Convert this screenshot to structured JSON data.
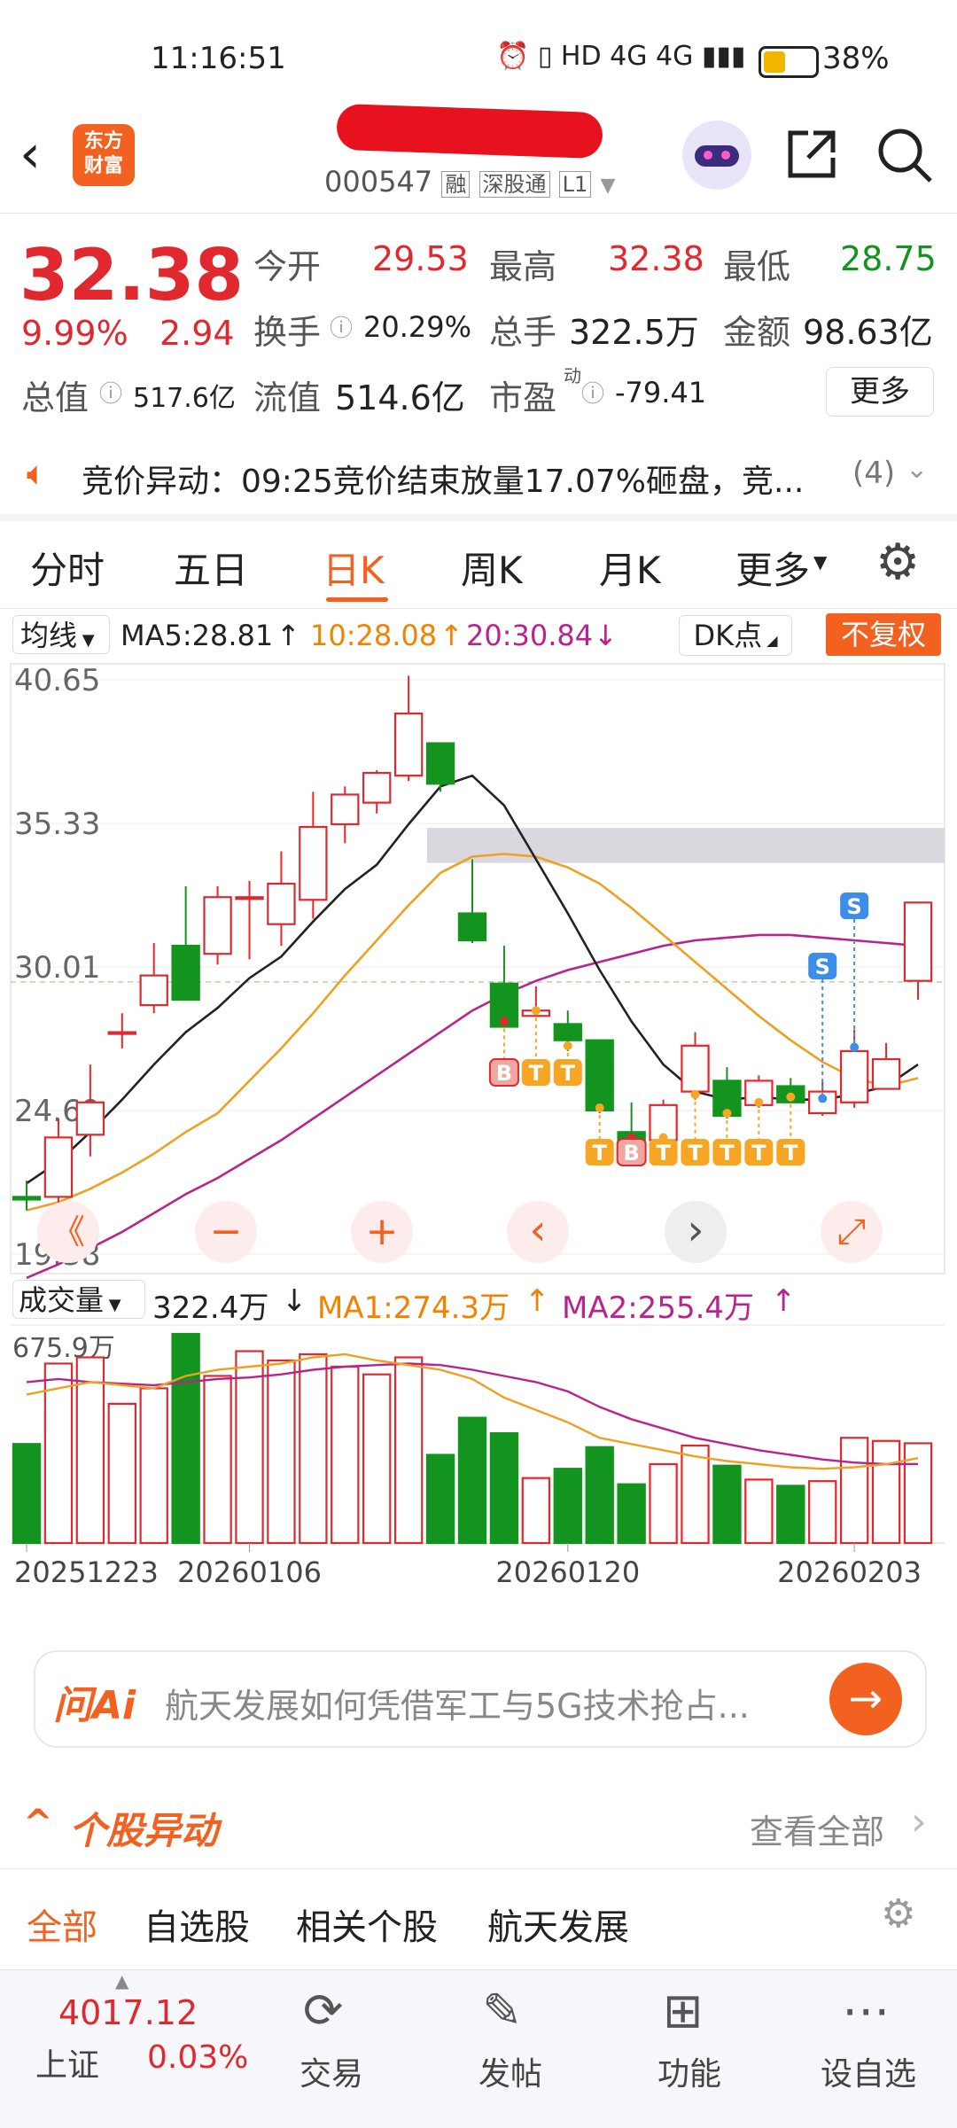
{
  "status": {
    "time": "11:16:51",
    "battery": "38%"
  },
  "header": {
    "logo_line1": "东方",
    "logo_line2": "财富",
    "code": "000547",
    "tag1": "融",
    "tag2": "深股通",
    "tag3": "L1"
  },
  "quote": {
    "price": "32.38",
    "change_pct": "9.99%",
    "change": "2.94",
    "open_label": "今开",
    "open": "29.53",
    "high_label": "最高",
    "high": "32.38",
    "low_label": "最低",
    "low": "28.75",
    "turnover_label": "换手",
    "turnover": "20.29%",
    "volume_label": "总手",
    "volume": "322.5万",
    "amount_label": "金额",
    "amount": "98.63亿",
    "mktcap_label": "总值",
    "mktcap": "517.6亿",
    "float_label": "流值",
    "float": "514.6亿",
    "pe_label": "市盈",
    "pe_sup": "动",
    "pe": "-79.41",
    "more": "更多"
  },
  "alert": {
    "text": "竞价异动：09:25竞价结束放量17.07%砸盘，竞...",
    "count": "(4)"
  },
  "tabs": [
    "分时",
    "五日",
    "日K",
    "周K",
    "月K",
    "更多"
  ],
  "indicator": {
    "ma_label": "均线",
    "ma5": "MA5:28.81",
    "ma10": "10:28.08",
    "ma20": "20:30.84",
    "dk": "DK点",
    "fq": "不复权"
  },
  "volume_bar": {
    "label": "成交量",
    "value": "322.4万",
    "ma1": "MA1:274.3万",
    "ma2": "MA2:255.4万",
    "max": "675.9万"
  },
  "colors": {
    "up": "#e0282e",
    "down": "#13941e",
    "accent": "#f2611f",
    "ma5": "#222222",
    "ma10": "#f0a020",
    "ma20": "#b8238c"
  },
  "chart_data": {
    "type": "candlestick",
    "y_ticks": [
      "40.65",
      "35.33",
      "30.01",
      "24.69",
      "19.38"
    ],
    "ylim": [
      19.38,
      40.65
    ],
    "x_labels": [
      "20251223",
      "20260106",
      "20260120",
      "20260203"
    ],
    "candles": [
      {
        "o": 21.5,
        "h": 22.1,
        "l": 21.0,
        "c": 21.4,
        "v": 320
      },
      {
        "o": 21.5,
        "h": 24.4,
        "l": 21.2,
        "c": 23.7,
        "v": 580
      },
      {
        "o": 23.8,
        "h": 26.4,
        "l": 23.0,
        "c": 25.0,
        "v": 600
      },
      {
        "o": 27.6,
        "h": 28.3,
        "l": 27.0,
        "c": 27.6,
        "v": 450
      },
      {
        "o": 28.6,
        "h": 30.9,
        "l": 28.3,
        "c": 29.7,
        "v": 500
      },
      {
        "o": 30.8,
        "h": 33.0,
        "l": 29.0,
        "c": 28.8,
        "v": 675.9
      },
      {
        "o": 30.5,
        "h": 33.0,
        "l": 30.1,
        "c": 32.6,
        "v": 540
      },
      {
        "o": 32.6,
        "h": 33.2,
        "l": 30.3,
        "c": 32.6,
        "v": 620
      },
      {
        "o": 31.6,
        "h": 34.3,
        "l": 30.8,
        "c": 33.1,
        "v": 590
      },
      {
        "o": 32.5,
        "h": 36.5,
        "l": 31.8,
        "c": 35.2,
        "v": 610
      },
      {
        "o": 35.3,
        "h": 36.7,
        "l": 34.6,
        "c": 36.4,
        "v": 570
      },
      {
        "o": 36.1,
        "h": 37.3,
        "l": 35.7,
        "c": 37.2,
        "v": 545
      },
      {
        "o": 37.1,
        "h": 40.8,
        "l": 36.9,
        "c": 39.4,
        "v": 600
      },
      {
        "o": 38.3,
        "h": 38.3,
        "l": 36.5,
        "c": 36.8,
        "v": 285
      },
      {
        "o": 32.0,
        "h": 34.0,
        "l": 30.9,
        "c": 31.0,
        "v": 405
      },
      {
        "o": 29.4,
        "h": 30.8,
        "l": 27.8,
        "c": 27.8,
        "v": 355
      },
      {
        "o": 28.2,
        "h": 29.3,
        "l": 28.2,
        "c": 28.4,
        "v": 210
      },
      {
        "o": 27.9,
        "h": 28.4,
        "l": 26.9,
        "c": 27.3,
        "v": 240
      },
      {
        "o": 27.3,
        "h": 27.3,
        "l": 24.6,
        "c": 24.7,
        "v": 310
      },
      {
        "o": 23.9,
        "h": 25.0,
        "l": 23.5,
        "c": 23.4,
        "v": 190
      },
      {
        "o": 23.6,
        "h": 25.1,
        "l": 23.5,
        "c": 24.9,
        "v": 255
      },
      {
        "o": 25.4,
        "h": 27.6,
        "l": 25.1,
        "c": 27.1,
        "v": 315
      },
      {
        "o": 25.8,
        "h": 26.3,
        "l": 24.4,
        "c": 24.5,
        "v": 250
      },
      {
        "o": 24.9,
        "h": 26.0,
        "l": 24.8,
        "c": 25.8,
        "v": 205
      },
      {
        "o": 25.6,
        "h": 25.9,
        "l": 25.0,
        "c": 25.0,
        "v": 185
      },
      {
        "o": 24.6,
        "h": 25.8,
        "l": 24.5,
        "c": 25.4,
        "v": 200
      },
      {
        "o": 25.0,
        "h": 27.7,
        "l": 24.8,
        "c": 26.9,
        "v": 340
      },
      {
        "o": 25.5,
        "h": 27.2,
        "l": 25.5,
        "c": 26.6,
        "v": 330
      },
      {
        "o": 29.5,
        "h": 32.4,
        "l": 28.8,
        "c": 32.4,
        "v": 322.4
      }
    ],
    "ma5": [
      22.0,
      22.8,
      23.9,
      25.1,
      26.4,
      27.6,
      28.5,
      29.6,
      30.4,
      31.7,
      32.9,
      33.8,
      35.3,
      36.7,
      37.1,
      36.0,
      34.0,
      32.0,
      29.9,
      28.0,
      26.4,
      25.4,
      25.1,
      25.2,
      25.1,
      25.1,
      25.3,
      25.6,
      26.4
    ],
    "ma10": [
      21.0,
      21.3,
      21.8,
      22.4,
      23.1,
      23.9,
      24.6,
      25.8,
      27.0,
      28.3,
      29.7,
      31.0,
      32.3,
      33.5,
      34.1,
      34.2,
      34.1,
      33.7,
      33.1,
      32.2,
      31.2,
      30.2,
      29.2,
      28.2,
      27.3,
      26.5,
      25.9,
      25.6,
      25.9
    ],
    "ma20": [
      18.5,
      19.0,
      19.6,
      20.2,
      20.9,
      21.6,
      22.2,
      22.9,
      23.6,
      24.4,
      25.2,
      26.0,
      26.8,
      27.6,
      28.4,
      29.0,
      29.5,
      29.9,
      30.2,
      30.5,
      30.8,
      31.0,
      31.1,
      31.2,
      31.2,
      31.1,
      31.0,
      30.9,
      30.8
    ],
    "vol_ma1": [
      480,
      500,
      520,
      510,
      500,
      540,
      560,
      570,
      580,
      600,
      610,
      590,
      575,
      560,
      530,
      470,
      430,
      390,
      340,
      320,
      300,
      280,
      265,
      255,
      245,
      240,
      245,
      255,
      274.3
    ],
    "vol_ma2": [
      520,
      530,
      520,
      515,
      510,
      520,
      530,
      535,
      545,
      560,
      570,
      575,
      580,
      575,
      560,
      540,
      520,
      490,
      440,
      400,
      370,
      340,
      320,
      300,
      285,
      270,
      260,
      255,
      255.4
    ],
    "signals": [
      {
        "i": 15,
        "t": "B"
      },
      {
        "i": 16,
        "t": "T"
      },
      {
        "i": 17,
        "t": "T"
      },
      {
        "i": 18,
        "t": "T"
      },
      {
        "i": 19,
        "t": "B"
      },
      {
        "i": 20,
        "t": "T"
      },
      {
        "i": 21,
        "t": "T"
      },
      {
        "i": 22,
        "t": "T"
      },
      {
        "i": 23,
        "t": "T"
      },
      {
        "i": 24,
        "t": "T"
      },
      {
        "i": 25,
        "t": "S"
      },
      {
        "i": 26,
        "t": "S"
      }
    ]
  },
  "chart_buttons": [
    "《",
    "−",
    "+",
    "‹",
    "›",
    "⤢"
  ],
  "ask": {
    "brand": "问Ai",
    "text": "航天发展如何凭借军工与5G技术抢占..."
  },
  "stock_moves": {
    "title": "个股异动",
    "view_all": "查看全部"
  },
  "filters": [
    "全部",
    "自选股",
    "相关个股",
    "航天发展"
  ],
  "bottom_nav": {
    "index_value": "4017.12",
    "index_name": "上证",
    "index_change": "0.03%",
    "items": [
      "交易",
      "发帖",
      "功能",
      "设自选"
    ]
  }
}
